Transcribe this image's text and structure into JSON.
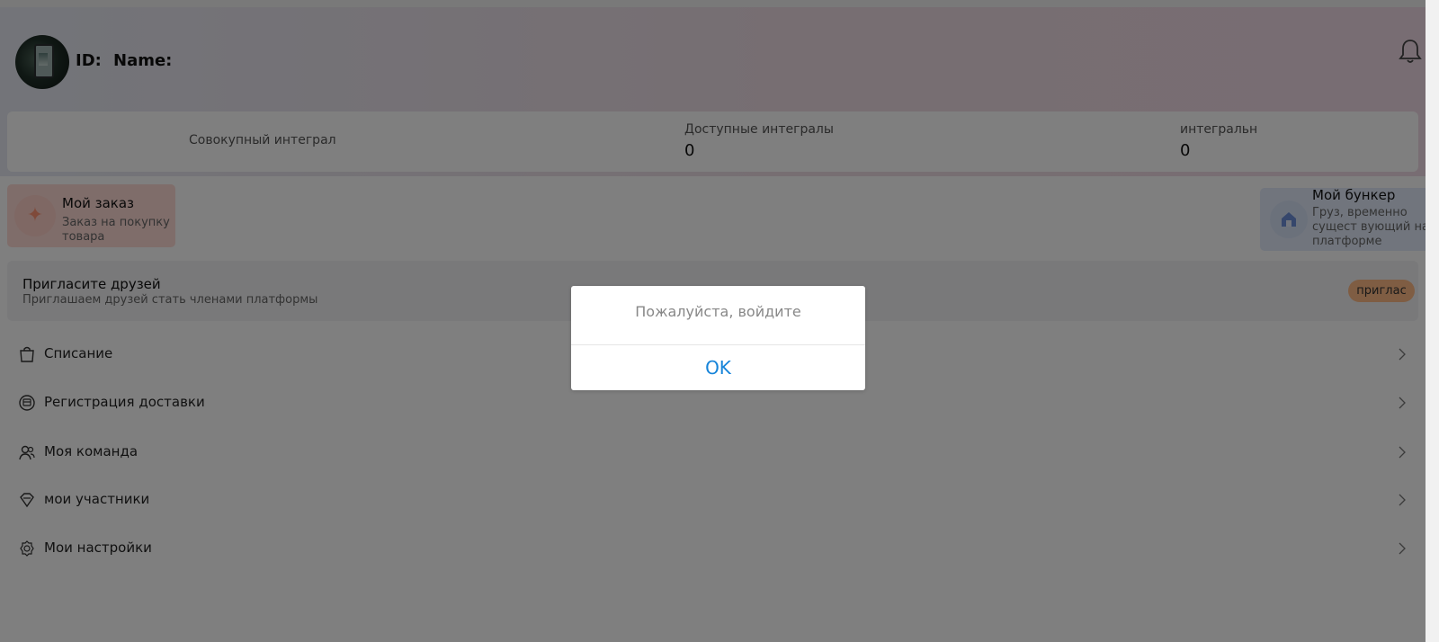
{
  "header": {
    "id_label": "ID:",
    "name_label": "Name:"
  },
  "stats": [
    {
      "label": "Совокупный интеграл",
      "value": ""
    },
    {
      "label": "Доступные интегралы",
      "value": "0"
    },
    {
      "label": "интегральн",
      "value": "0"
    }
  ],
  "cards": {
    "order": {
      "title": "Мой заказ",
      "subtitle_line1": "Заказ на покупку",
      "subtitle_line2": "товара"
    },
    "bunker": {
      "title": "Мой бункер",
      "subtitle_line1": "Груз, временно",
      "subtitle_line2": "сущест вующий на",
      "subtitle_line3": "платформе"
    }
  },
  "invite": {
    "title": "Пригласите друзей",
    "subtitle": "Приглашаем друзей стать членами платформы",
    "button": "приглас"
  },
  "menu": [
    {
      "label": "Списание",
      "icon": "shopping-bag-icon"
    },
    {
      "label": "Регистрация доставки",
      "icon": "delivery-box-icon"
    },
    {
      "label": "Моя команда",
      "icon": "team-icon"
    },
    {
      "label": "мои участники",
      "icon": "diamond-icon"
    },
    {
      "label": "Мои настройки",
      "icon": "settings-gear-icon"
    }
  ],
  "dialog": {
    "message": "Пожалуйста, войдите",
    "ok": "OK"
  },
  "colors": {
    "dialog_button": "#1684d9",
    "invite_button": "#ffbb87",
    "order_card": "#ffdad5",
    "bunker_card": "#e2ebfb"
  }
}
